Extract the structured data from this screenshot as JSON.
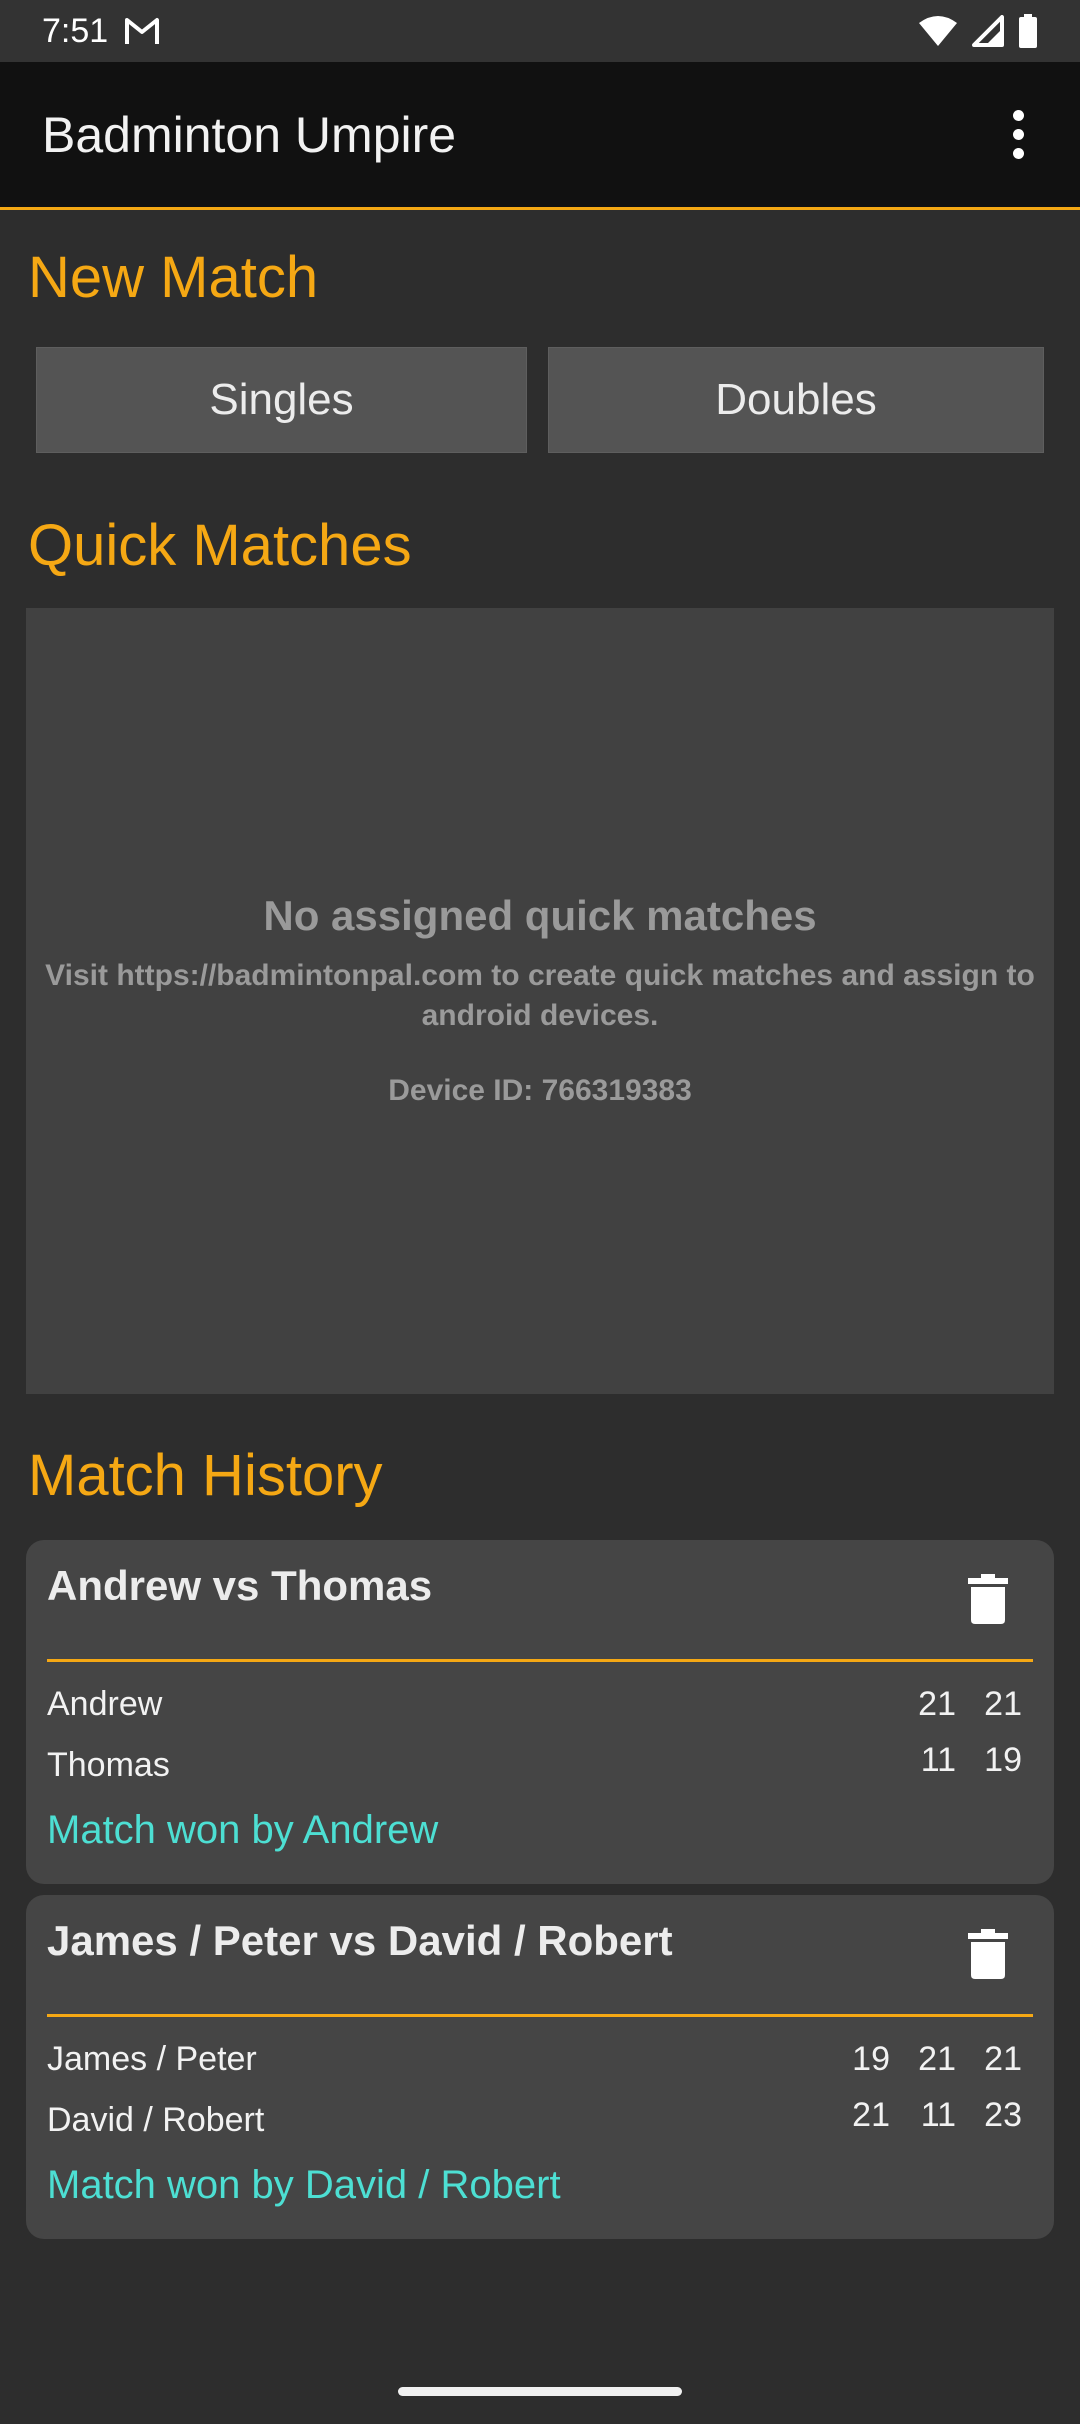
{
  "status_bar": {
    "time": "7:51",
    "notification_icon": "gmail-icon",
    "wifi_icon": "wifi-icon",
    "signal_icon": "signal-icon",
    "battery_icon": "battery-icon"
  },
  "app_bar": {
    "title": "Badminton Umpire",
    "menu_icon": "more-vert-icon"
  },
  "new_match": {
    "title": "New Match",
    "singles_label": "Singles",
    "doubles_label": "Doubles"
  },
  "quick_matches": {
    "title": "Quick Matches",
    "empty_heading": "No assigned quick matches",
    "empty_body": "Visit https://badmintonpal.com to create quick matches and assign to android devices.",
    "device_id": "Device ID: 766319383"
  },
  "history": {
    "title": "Match History",
    "matches": [
      {
        "title": "Andrew vs Thomas",
        "players": [
          {
            "name": "Andrew",
            "scores": [
              "21",
              "21"
            ]
          },
          {
            "name": "Thomas",
            "scores": [
              "11",
              "19"
            ]
          }
        ],
        "result": "Match won by Andrew"
      },
      {
        "title": "James / Peter vs David / Robert",
        "players": [
          {
            "name": "James / Peter",
            "scores": [
              "19",
              "21",
              "21"
            ]
          },
          {
            "name": "David / Robert",
            "scores": [
              "21",
              "11",
              "23"
            ]
          }
        ],
        "result": "Match won by David / Robert"
      }
    ]
  },
  "colors": {
    "accent": "#f5a814",
    "winner": "#4ddfd3",
    "background": "#2d2d2d",
    "card": "#454545"
  }
}
